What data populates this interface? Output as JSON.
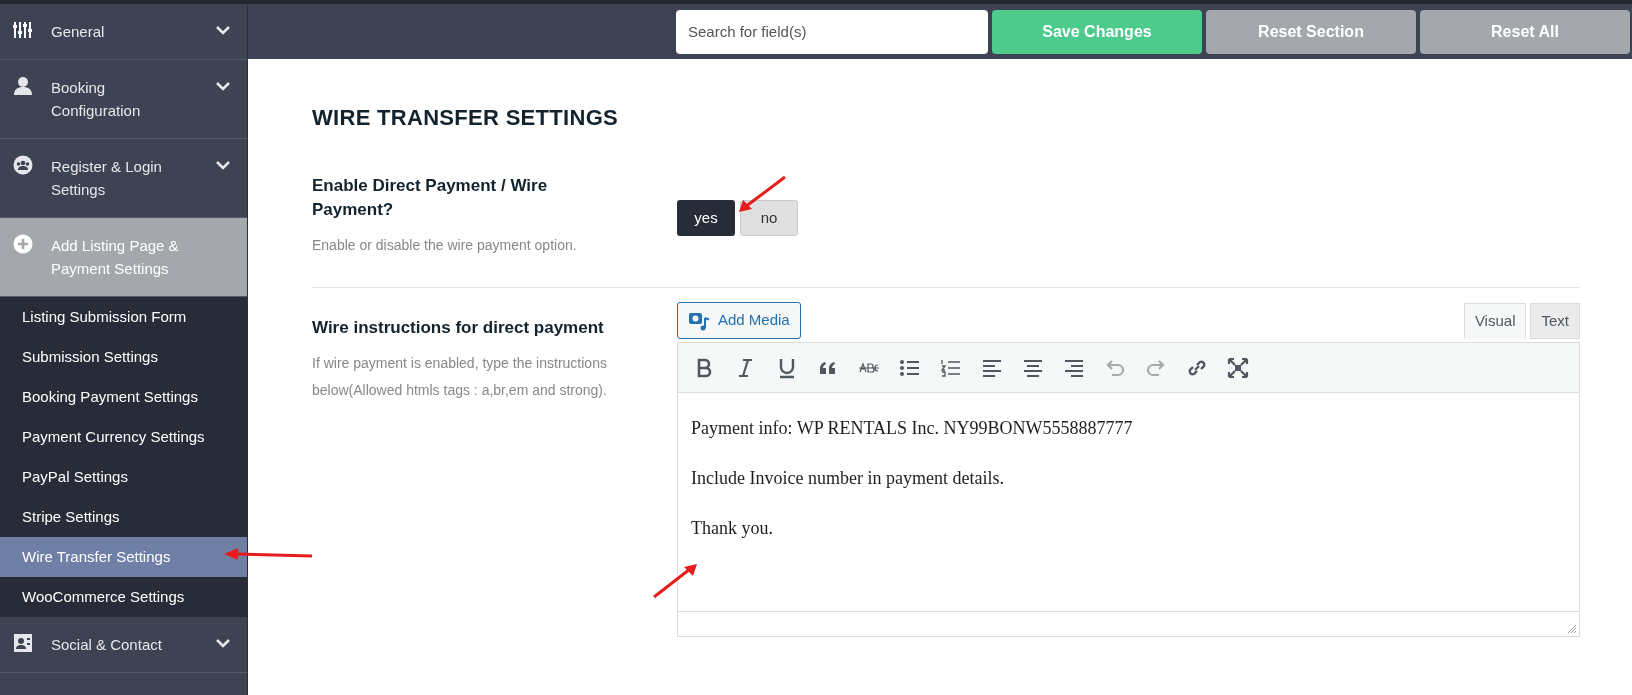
{
  "sidebar": {
    "items": [
      {
        "label": "General",
        "kind": "sliders",
        "expanded": false,
        "selected": false
      },
      {
        "label": "Booking Configuration",
        "kind": "user",
        "expanded": false,
        "selected": false
      },
      {
        "label": "Register & Login Settings",
        "kind": "group",
        "expanded": false,
        "selected": false
      },
      {
        "label": "Add Listing Page & Payment Settings",
        "kind": "plus",
        "expanded": true,
        "selected": true,
        "children": [
          {
            "label": "Listing Submission Form",
            "selected": false
          },
          {
            "label": "Submission Settings",
            "selected": false
          },
          {
            "label": "Booking Payment Settings",
            "selected": false
          },
          {
            "label": "Payment Currency Settings",
            "selected": false
          },
          {
            "label": "PayPal Settings",
            "selected": false
          },
          {
            "label": "Stripe Settings",
            "selected": false
          },
          {
            "label": "Wire Transfer Settings",
            "selected": true
          },
          {
            "label": "WooCommerce Settings",
            "selected": false
          }
        ]
      },
      {
        "label": "Social & Contact",
        "kind": "contact",
        "expanded": false,
        "selected": false
      }
    ]
  },
  "toolbar": {
    "search": {
      "placeholder": "Search for field(s)"
    },
    "buttons": [
      {
        "label": "Save Changes",
        "kind": "primary"
      },
      {
        "label": "Reset Section",
        "kind": "secondary"
      },
      {
        "label": "Reset All",
        "kind": "secondary"
      }
    ]
  },
  "section": {
    "title": "WIRE TRANSFER SETTINGS",
    "fields": [
      {
        "kind": "toggle",
        "label": "Enable Direct Payment / Wire Payment?",
        "description": "Enable or disable the wire payment option.",
        "options": [
          {
            "label": "yes",
            "selected": true
          },
          {
            "label": "no",
            "selected": false
          }
        ]
      },
      {
        "kind": "editor",
        "label": "Wire instructions for direct payment",
        "description": "If wire payment is enabled, type the instructions below(Allowed htmls tags : a,br,em and strong).",
        "add_media": "Add Media",
        "tabs": [
          {
            "label": "Visual",
            "selected": true
          },
          {
            "label": "Text",
            "selected": false
          }
        ],
        "paragraphs": [
          "Payment info: WP RENTALS Inc. NY99BONW5558887777",
          "Include Invoice number in payment details.",
          "Thank you."
        ]
      }
    ]
  }
}
